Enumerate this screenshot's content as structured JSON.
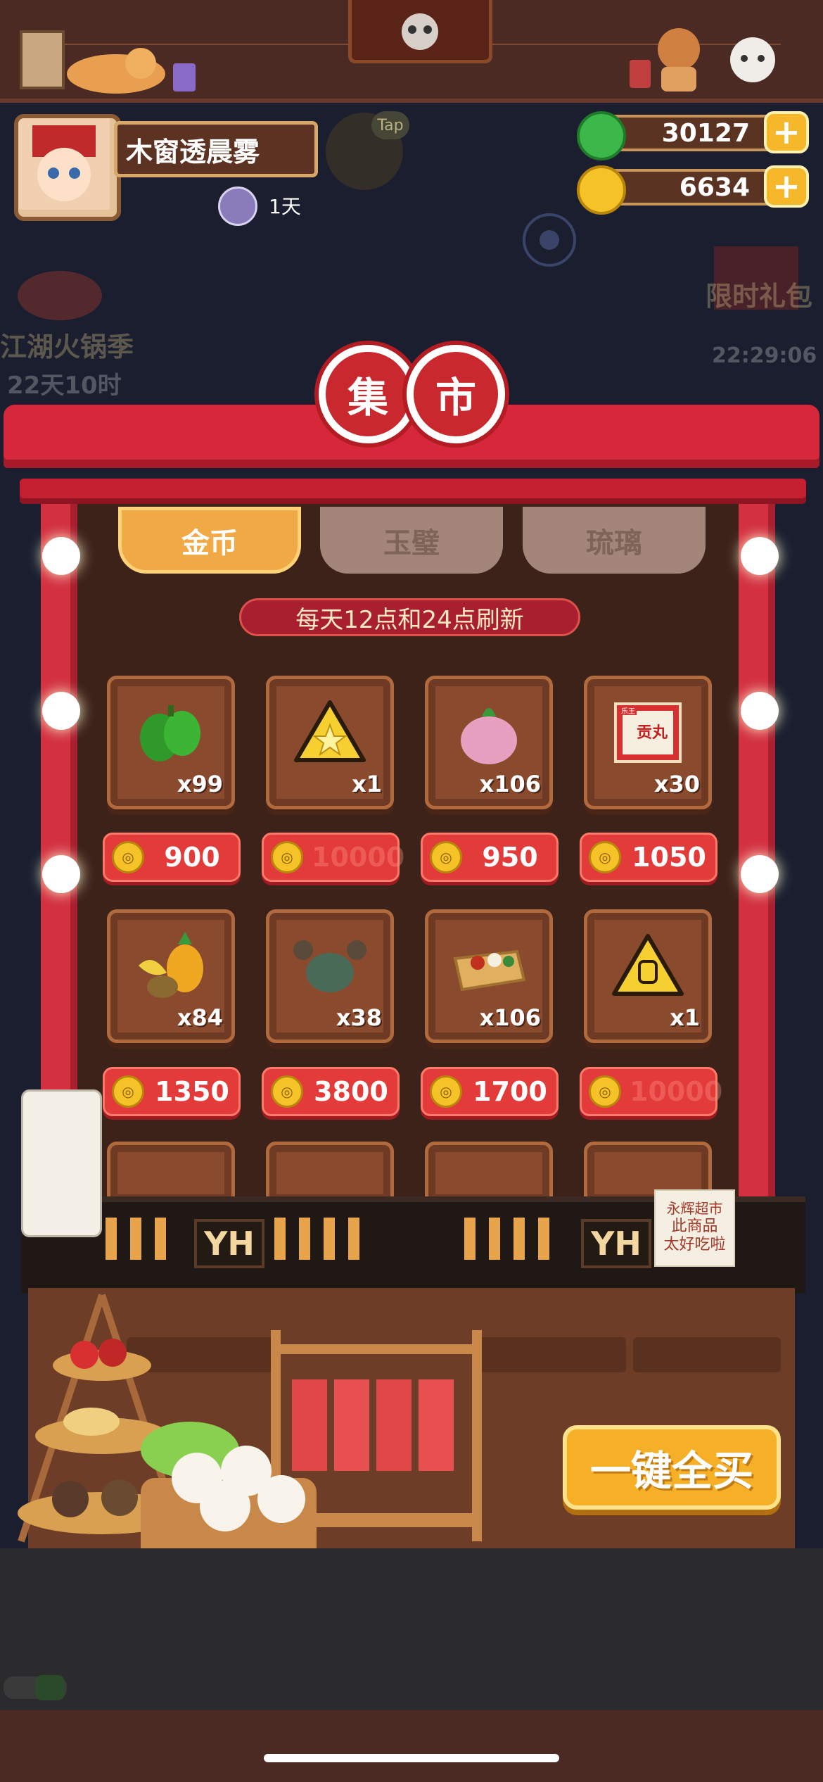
{
  "player": {
    "name": "木窗透晨雾",
    "days": "1天"
  },
  "header": {
    "tap_label": "Tap"
  },
  "resources": [
    {
      "type": "jade",
      "value": "30127",
      "plus": "+"
    },
    {
      "type": "coin",
      "value": "6634",
      "plus": "+"
    }
  ],
  "side_events": {
    "left_title": "江湖火锅季",
    "left_timer": "22天10时",
    "right_title": "限时礼包",
    "right_timer": "22:29:06"
  },
  "market": {
    "title_chars": [
      "集",
      "市"
    ],
    "tabs": [
      {
        "label": "金币",
        "active": true
      },
      {
        "label": "玉璧",
        "active": false
      },
      {
        "label": "琉璃",
        "active": false
      }
    ],
    "refresh_notice": "每天12点和24点刷新",
    "items": [
      {
        "name": "green-pepper",
        "qty": "x99",
        "price": "900"
      },
      {
        "name": "star-ticket",
        "qty": "x1",
        "price": "10000",
        "faded": true
      },
      {
        "name": "onion",
        "qty": "x106",
        "price": "950"
      },
      {
        "name": "meatball-pack",
        "qty": "x30",
        "price": "1050"
      },
      {
        "name": "fruit-basket",
        "qty": "x84",
        "price": "1350"
      },
      {
        "name": "crab",
        "qty": "x38",
        "price": "3800"
      },
      {
        "name": "bento-box",
        "qty": "x106",
        "price": "1700"
      },
      {
        "name": "chef-ticket",
        "qty": "x1",
        "price": "10000",
        "faded": true
      }
    ],
    "pack_label": "贡丸",
    "pack_brand": "乐王"
  },
  "counter": {
    "sign_left": "YH",
    "sign_right": "YH",
    "note_lines": [
      "永辉超市",
      "此商品",
      "太好吃啦"
    ],
    "buy_all_label": "一键全买"
  },
  "colors": {
    "market_red": "#d6283a",
    "tab_active": "#f0a945",
    "price_red": "#e33a3a",
    "gold": "#f6b028"
  }
}
